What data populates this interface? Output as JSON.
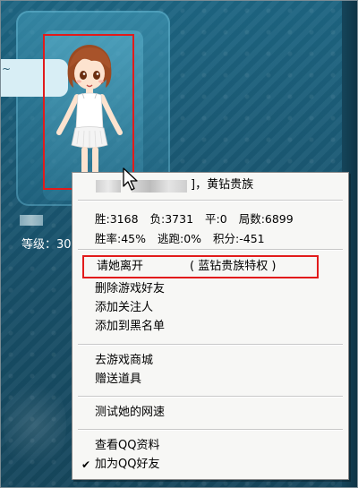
{
  "left_panel": {
    "chat_text": "~",
    "level_label": "等级：30"
  },
  "context_menu": {
    "header": "]，黄钻贵族",
    "stats_row1": {
      "wins": "胜:3168",
      "losses": "负:3731",
      "draws": "平:0",
      "games": "局数:6899"
    },
    "stats_row2": {
      "win_rate": "胜率:45%",
      "escape": "逃跑:0%",
      "points": "积分:-451"
    },
    "leave": {
      "label": "请她离开",
      "note": "( 蓝钻贵族特权 )"
    },
    "group1": [
      "删除游戏好友",
      "添加关注人",
      "添加到黑名单"
    ],
    "group2": [
      "去游戏商城",
      "赠送道具"
    ],
    "group3": [
      "测试她的网速"
    ],
    "group4": [
      "查看QQ资料",
      "加为QQ好友"
    ],
    "checked_item": "加为QQ好友"
  },
  "colors": {
    "highlight_red": "#e21b1b",
    "menu_bg": "#f7f7f5",
    "game_bg": "#1c5a74"
  },
  "icons": [
    "cursor-arrow-icon",
    "checkmark-icon"
  ]
}
